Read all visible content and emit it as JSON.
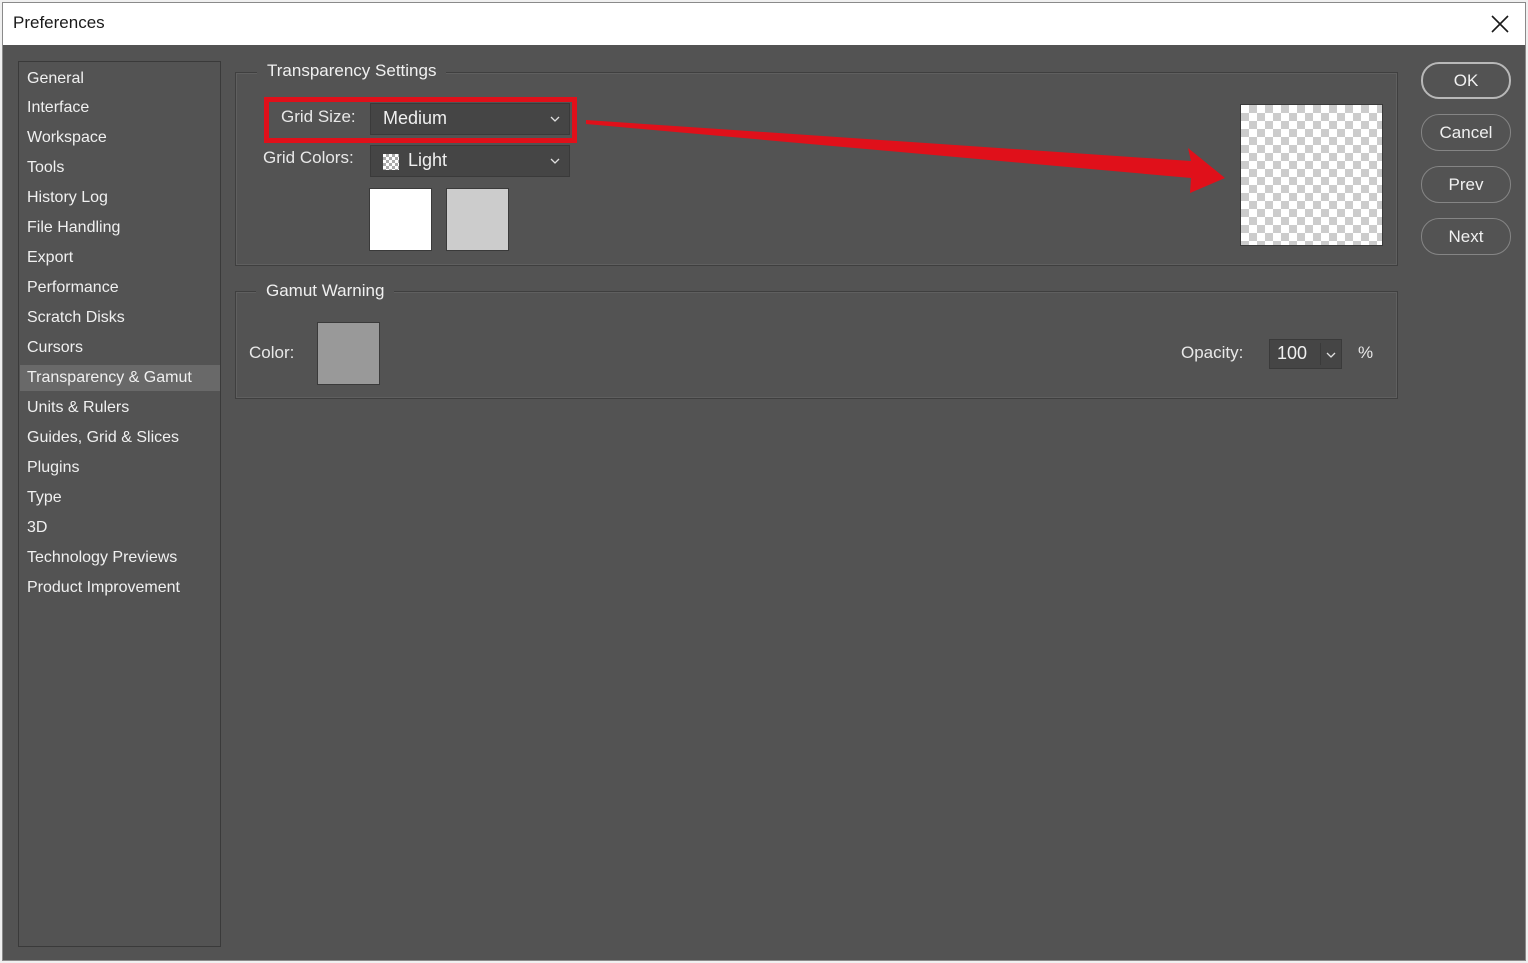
{
  "window": {
    "title": "Preferences"
  },
  "sidebar": {
    "items": [
      {
        "label": "General"
      },
      {
        "label": "Interface"
      },
      {
        "label": "Workspace"
      },
      {
        "label": "Tools"
      },
      {
        "label": "History Log"
      },
      {
        "label": "File Handling"
      },
      {
        "label": "Export"
      },
      {
        "label": "Performance"
      },
      {
        "label": "Scratch Disks"
      },
      {
        "label": "Cursors"
      },
      {
        "label": "Transparency & Gamut"
      },
      {
        "label": "Units & Rulers"
      },
      {
        "label": "Guides, Grid & Slices"
      },
      {
        "label": "Plugins"
      },
      {
        "label": "Type"
      },
      {
        "label": "3D"
      },
      {
        "label": "Technology Previews"
      },
      {
        "label": "Product Improvement"
      }
    ],
    "selected": "Transparency & Gamut"
  },
  "transparency": {
    "title": "Transparency Settings",
    "grid_size_label": "Grid Size:",
    "grid_size_value": "Medium",
    "grid_colors_label": "Grid Colors:",
    "grid_colors_value": "Light",
    "swatch1_color": "#ffffff",
    "swatch2_color": "#cccccc"
  },
  "gamut": {
    "title": "Gamut Warning",
    "color_label": "Color:",
    "color_value": "#999999",
    "opacity_label": "Opacity:",
    "opacity_value": "100",
    "opacity_unit": "%"
  },
  "buttons": {
    "ok": "OK",
    "cancel": "Cancel",
    "prev": "Prev",
    "next": "Next"
  },
  "colors": {
    "background": "#535353",
    "annotation": "#e0101a"
  },
  "icons": {
    "close": "close-icon",
    "chevron": "chevron-down-icon",
    "checker": "checkerboard-icon"
  }
}
